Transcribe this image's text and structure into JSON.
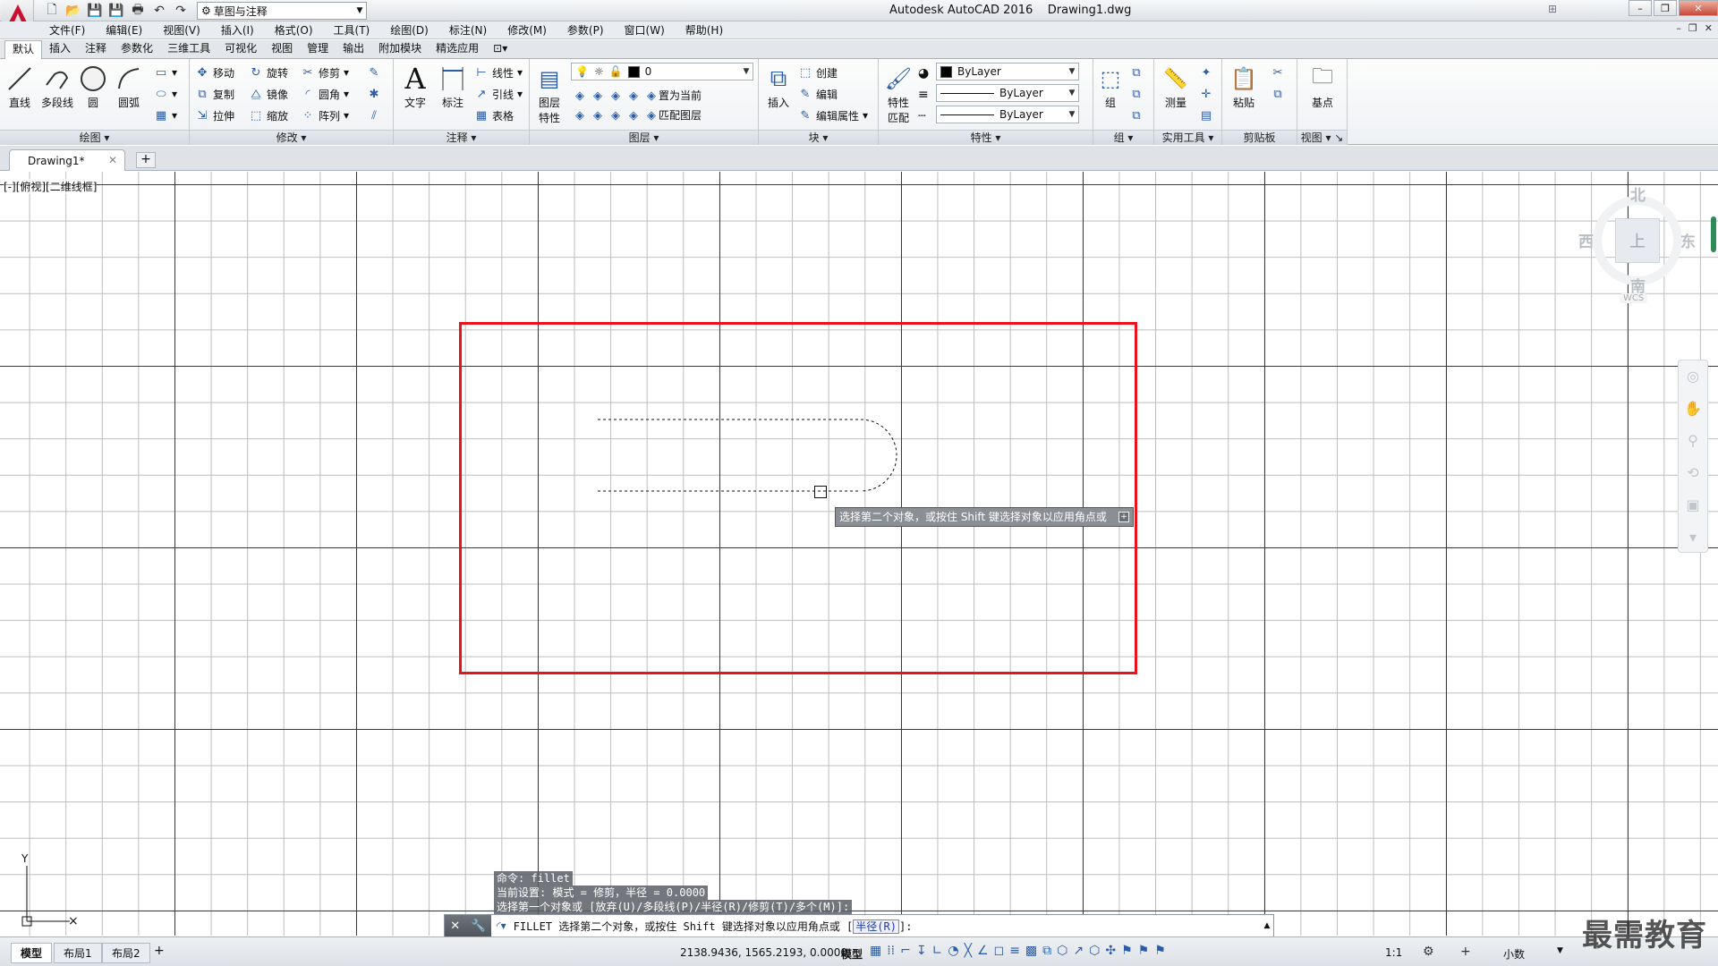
{
  "title_bar": {
    "app_name": "Autodesk AutoCAD 2016",
    "file_name": "Drawing1.dwg",
    "workspace": "草图与注释"
  },
  "menu": [
    "文件(F)",
    "编辑(E)",
    "视图(V)",
    "插入(I)",
    "格式(O)",
    "工具(T)",
    "绘图(D)",
    "标注(N)",
    "修改(M)",
    "参数(P)",
    "窗口(W)",
    "帮助(H)"
  ],
  "ribbon_tabs": [
    "默认",
    "插入",
    "注释",
    "参数化",
    "三维工具",
    "可视化",
    "视图",
    "管理",
    "输出",
    "附加模块",
    "精选应用"
  ],
  "ribbon": {
    "draw": {
      "title": "绘图",
      "line": "直线",
      "polyline": "多段线",
      "circle": "圆",
      "arc": "圆弧"
    },
    "modify": {
      "title": "修改",
      "move": "移动",
      "rotate": "旋转",
      "trim": "修剪",
      "copy": "复制",
      "mirror": "镜像",
      "fillet": "圆角",
      "stretch": "拉伸",
      "scale": "缩放",
      "array": "阵列"
    },
    "annotate": {
      "title": "注释",
      "text": "文字",
      "dimension": "标注",
      "linear": "线性",
      "leader": "引线",
      "table": "表格"
    },
    "layers": {
      "title": "图层",
      "properties_line1": "图层",
      "properties_line2": "特性",
      "layer_value": "0",
      "set_current": "置为当前",
      "match_layer": "匹配图层"
    },
    "block": {
      "title": "块",
      "insert": "插入",
      "create": "创建",
      "edit": "编辑",
      "edit_attributes": "编辑属性"
    },
    "properties": {
      "title": "特性",
      "match_line1": "特性",
      "match_line2": "匹配",
      "color": "ByLayer",
      "linetype": "ByLayer",
      "lineweight": "ByLayer"
    },
    "groups": {
      "title": "组",
      "group": "组"
    },
    "utilities": {
      "title": "实用工具",
      "measure": "测量"
    },
    "clipboard": {
      "title": "剪贴板",
      "paste": "粘贴"
    },
    "view": {
      "title": "视图",
      "base": "基点"
    }
  },
  "doc_tab": "Drawing1*",
  "viewport_label": "[-][俯视][二维线框]",
  "viewcube": {
    "north": "北",
    "south": "南",
    "east": "东",
    "west": "西",
    "top": "上",
    "wcs": "WCS"
  },
  "tooltip": "选择第二个对象，或按住 Shift 键选择对象以应用角点或",
  "command_history": [
    "命令:  fillet",
    "当前设置: 模式 = 修剪，半径 = 0.0000",
    "选择第一个对象或 [放弃(U)/多段线(P)/半径(R)/修剪(T)/多个(M)]:"
  ],
  "command_line": {
    "prompt": "FILLET 选择第二个对象，或按住 Shift 键选择对象以应用角点或 [",
    "option": "半径(R)",
    "suffix": "]:"
  },
  "status_bar": {
    "layouts": [
      "模型",
      "布局1",
      "布局2"
    ],
    "coordinates": "2138.9436, 1565.2193, 0.0000",
    "space": "模型",
    "scale": "1:1",
    "units": "小数"
  },
  "watermark": "最需教育",
  "colors": {
    "selection_rect": "#e8131b",
    "accent": "#2a5ca8"
  }
}
